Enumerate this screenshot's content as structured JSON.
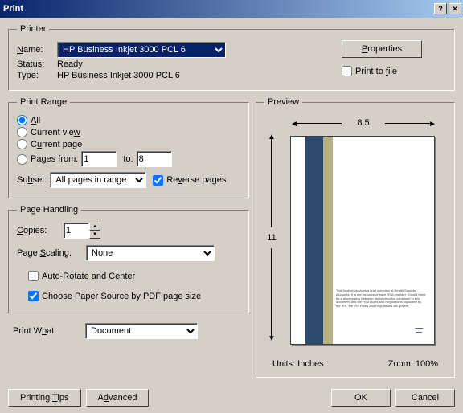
{
  "titlebar": {
    "title": "Print"
  },
  "printer": {
    "legend": "Printer",
    "name_label": "Name:",
    "name_value": "HP Business Inkjet 3000 PCL 6",
    "status_label": "Status:",
    "status_value": "Ready",
    "type_label": "Type:",
    "type_value": "HP Business Inkjet 3000 PCL 6",
    "properties_btn": "Properties",
    "print_to_file": "Print to file"
  },
  "range": {
    "legend": "Print Range",
    "all": "All",
    "current_view": "Current view",
    "current_page": "Current page",
    "pages_from": "Pages from:",
    "from_value": "1",
    "to_label": "to:",
    "to_value": "8",
    "subset_label": "Subset:",
    "subset_value": "All pages in range",
    "reverse": "Reverse pages"
  },
  "handling": {
    "legend": "Page Handling",
    "copies_label": "Copies:",
    "copies_value": "1",
    "scaling_label": "Page Scaling:",
    "scaling_value": "None",
    "auto_rotate": "Auto-Rotate and Center",
    "choose_paper": "Choose Paper Source by PDF page size"
  },
  "print_what": {
    "label": "Print What:",
    "value": "Document"
  },
  "preview": {
    "legend": "Preview",
    "width": "8.5",
    "height": "11",
    "units_label": "Units: Inches",
    "zoom_label": "Zoom: 100%"
  },
  "buttons": {
    "tips": "Printing Tips",
    "advanced": "Advanced",
    "ok": "OK",
    "cancel": "Cancel"
  }
}
